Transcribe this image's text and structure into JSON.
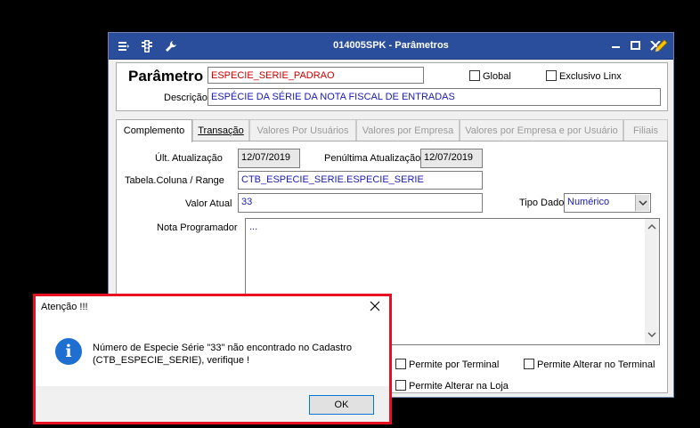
{
  "window": {
    "title": "014005SPK - Parâmetros",
    "title_bar_color": "#2a4e9c"
  },
  "header": {
    "parametro_label": "Parâmetro",
    "parametro_value": "ESPECIE_SERIE_PADRAO",
    "parametro_color": "#cc0000",
    "global_label": "Global",
    "exclusivo_label": "Exclusivo Linx",
    "descricao_label": "Descrição",
    "descricao_value": "ESPÉCIE DA SÉRIE DA NOTA FISCAL DE ENTRADAS"
  },
  "tabs": [
    {
      "label": "Complemento",
      "state": "active"
    },
    {
      "label": "Transação",
      "state": "normal"
    },
    {
      "label": "Valores Por Usuários",
      "state": "disabled"
    },
    {
      "label": "Valores por Empresa",
      "state": "disabled"
    },
    {
      "label": "Valores por Empresa e por Usuário",
      "state": "disabled"
    },
    {
      "label": "Filiais",
      "state": "disabled"
    }
  ],
  "complemento": {
    "ult_atualizacao_label": "Últ. Atualização",
    "ult_atualizacao_value": "12/07/2019",
    "penultima_label": "Penúltima Atualização",
    "penultima_value": "12/07/2019",
    "tabela_label": "Tabela.Coluna / Range",
    "tabela_value": "CTB_ESPECIE_SERIE.ESPECIE_SERIE",
    "valor_label": "Valor Atual",
    "valor_value": "33",
    "tipo_label": "Tipo Dado",
    "tipo_value": "Numérico",
    "nota_label": "Nota Programador",
    "nota_value": "...",
    "permite_terminal_label": "Permite por Terminal",
    "permite_alterar_terminal_label": "Permite Alterar no Terminal",
    "permite_alterar_loja_label": "Permite Alterar na Loja"
  },
  "dialog": {
    "title": "Atenção !!!",
    "message": "Número de Especie Série \"33\" não encontrado no Cadastro\n(CTB_ESPECIE_SERIE), verifique !",
    "ok_label": "OK",
    "icon": "info-icon",
    "border_color": "#e81123"
  }
}
